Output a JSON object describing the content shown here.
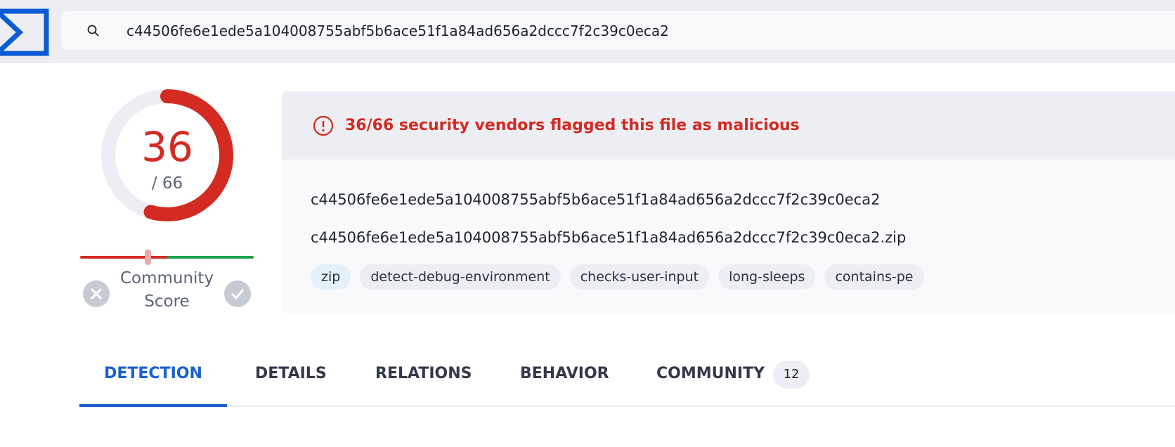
{
  "header": {
    "search_value": "c44506fe6e1ede5a104008755abf5b6ace51f1a84ad656a2dccc7f2c39c0eca2",
    "logo_color": "#0b5bd6"
  },
  "score": {
    "detections": "36",
    "total": "/ 66",
    "detected_fraction": 0.545,
    "color": "#d32a22"
  },
  "community": {
    "label": "Community Score",
    "score_fraction": 0.39
  },
  "alert": {
    "text": "36/66 security vendors flagged this file as malicious"
  },
  "file": {
    "hash": "c44506fe6e1ede5a104008755abf5b6ace51f1a84ad656a2dccc7f2c39c0eca2",
    "name": "c44506fe6e1ede5a104008755abf5b6ace51f1a84ad656a2dccc7f2c39c0eca2.zip",
    "tags": [
      "zip",
      "detect-debug-environment",
      "checks-user-input",
      "long-sleeps",
      "contains-pe"
    ]
  },
  "tabs": [
    {
      "label": "DETECTION",
      "active": true
    },
    {
      "label": "DETAILS"
    },
    {
      "label": "RELATIONS"
    },
    {
      "label": "BEHAVIOR"
    },
    {
      "label": "COMMUNITY",
      "badge": "12"
    }
  ]
}
